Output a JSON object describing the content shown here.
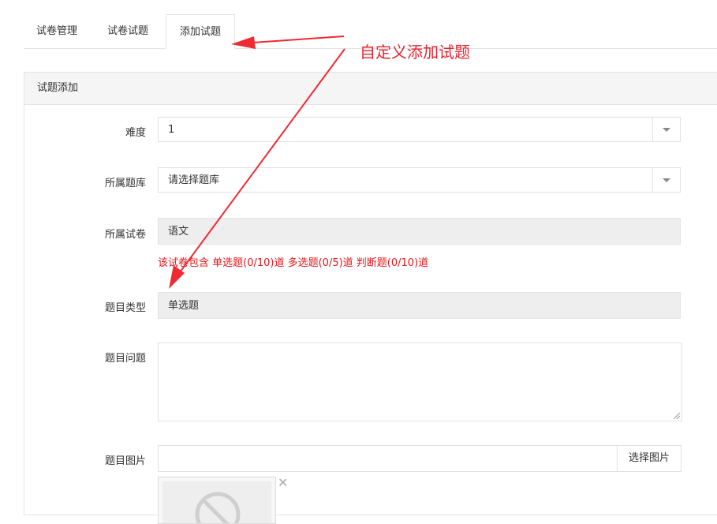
{
  "tabs": [
    {
      "label": "试卷管理"
    },
    {
      "label": "试卷试题"
    },
    {
      "label": "添加试题"
    }
  ],
  "annotation": {
    "text": "自定义添加试题",
    "color": "#e8232f"
  },
  "panel": {
    "title": "试题添加"
  },
  "form": {
    "difficulty": {
      "label": "难度",
      "value": "1"
    },
    "bank": {
      "label": "所属题库",
      "value": "请选择题库"
    },
    "paper": {
      "label": "所属试卷",
      "value": "语文"
    },
    "hint": "该试卷包含 单选题(0/10)道 多选题(0/5)道 判断题(0/10)道",
    "type": {
      "label": "题目类型",
      "value": "单选题"
    },
    "question": {
      "label": "题目问题",
      "value": ""
    },
    "image": {
      "label": "题目图片",
      "value": "",
      "button": "选择图片"
    }
  },
  "colors": {
    "hint": "#e3161b",
    "arrow": "#ee2b33",
    "readonly_bg": "#eeeeee"
  }
}
